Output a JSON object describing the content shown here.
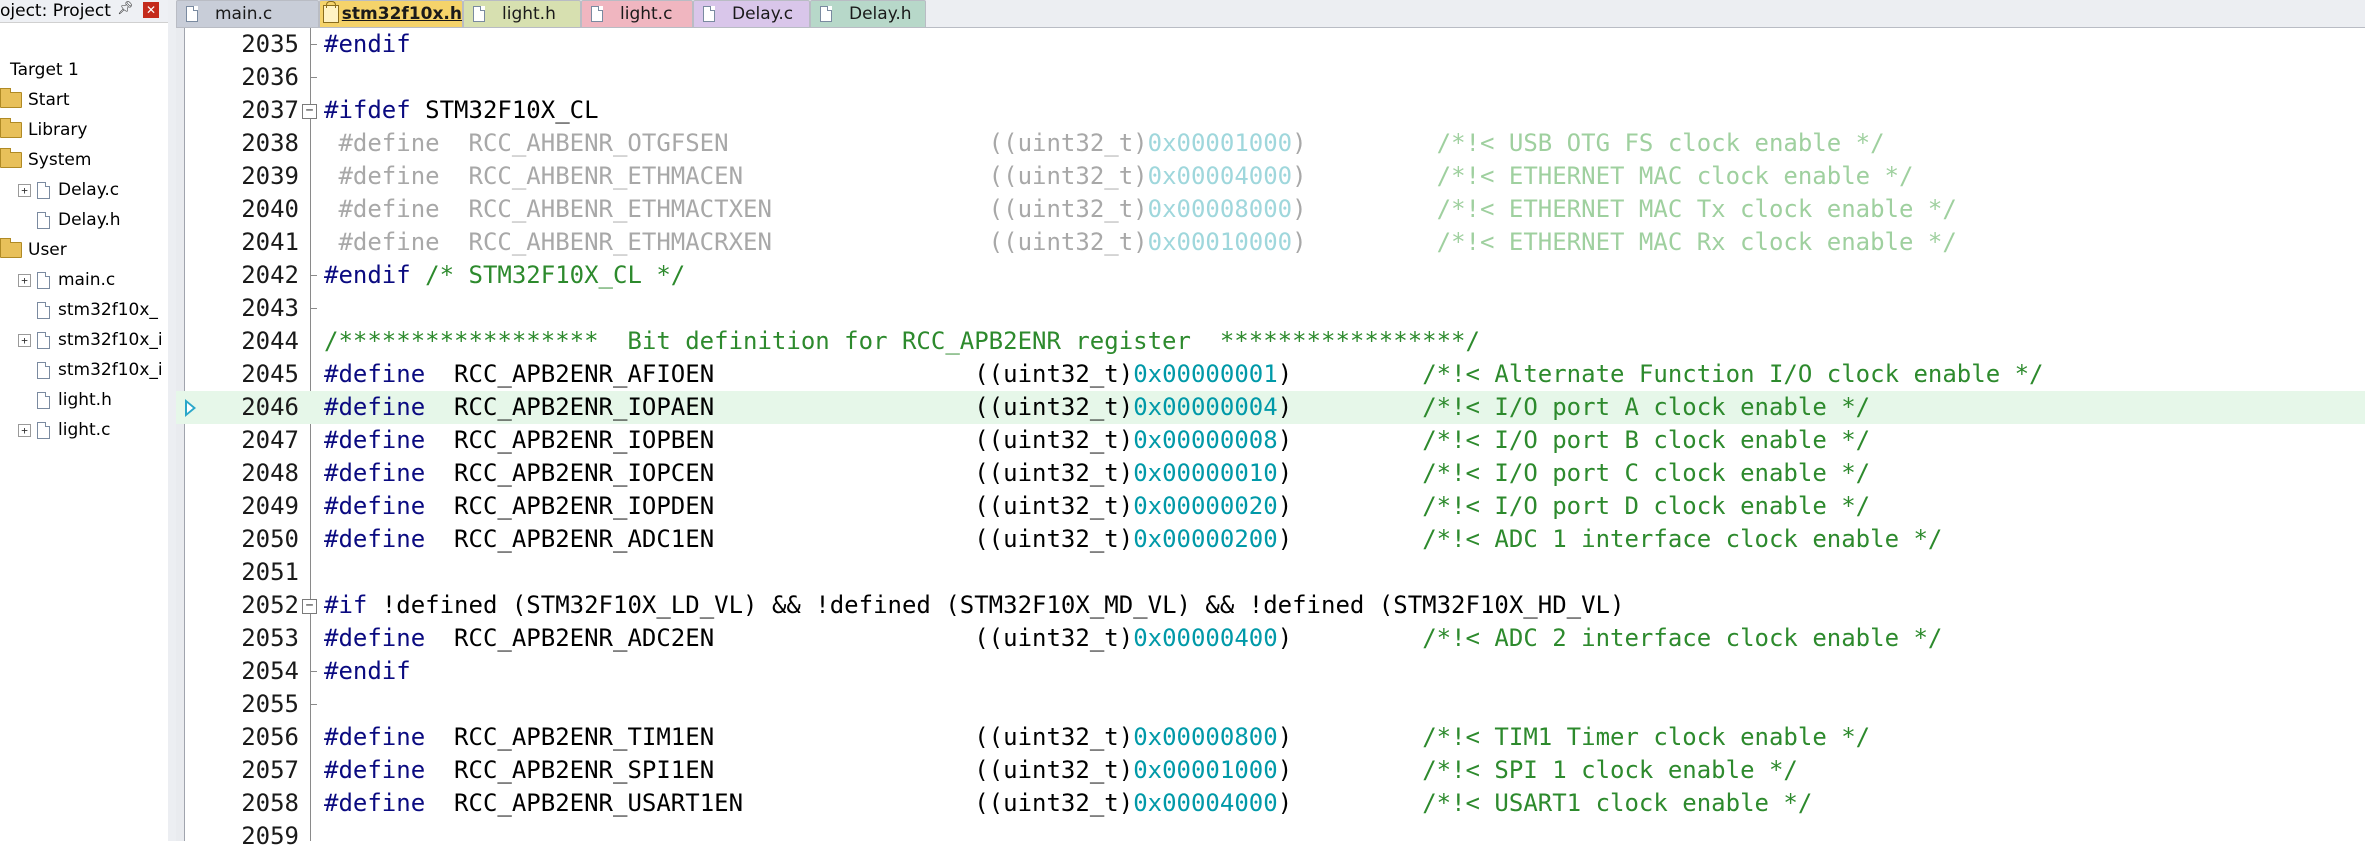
{
  "project_panel": {
    "title": "oject: Project",
    "pin_icon": "pin-icon",
    "close_icon": "close-icon",
    "items": [
      {
        "label": "Target 1",
        "level": 0,
        "type": "target",
        "expander": "",
        "icon": "target-icon"
      },
      {
        "label": "Start",
        "level": 1,
        "type": "folder",
        "expander": "",
        "icon": "folder-icon"
      },
      {
        "label": "Library",
        "level": 1,
        "type": "folder",
        "expander": "",
        "icon": "folder-icon"
      },
      {
        "label": "System",
        "level": 1,
        "type": "folder-open",
        "expander": "",
        "icon": "folder-open-icon"
      },
      {
        "label": "Delay.c",
        "level": 2,
        "type": "file",
        "expander": "+",
        "icon": "file-icon"
      },
      {
        "label": "Delay.h",
        "level": 2,
        "type": "file",
        "expander": "",
        "icon": "file-icon"
      },
      {
        "label": "User",
        "level": 1,
        "type": "folder-open",
        "expander": "",
        "icon": "folder-open-icon"
      },
      {
        "label": "main.c",
        "level": 2,
        "type": "file",
        "expander": "+",
        "icon": "file-icon"
      },
      {
        "label": "stm32f10x_",
        "level": 2,
        "type": "file",
        "expander": "",
        "icon": "file-icon"
      },
      {
        "label": "stm32f10x_i",
        "level": 2,
        "type": "file",
        "expander": "+",
        "icon": "file-icon"
      },
      {
        "label": "stm32f10x_i",
        "level": 2,
        "type": "file",
        "expander": "",
        "icon": "file-icon"
      },
      {
        "label": "light.h",
        "level": 2,
        "type": "file",
        "expander": "",
        "icon": "file-icon"
      },
      {
        "label": "light.c",
        "level": 2,
        "type": "file",
        "expander": "+",
        "icon": "file-icon"
      }
    ]
  },
  "tabs": [
    {
      "label": "main.c",
      "color": "#c8cdd8",
      "active": false,
      "icon": "file-icon"
    },
    {
      "label": "stm32f10x.h",
      "color": "#f5d36a",
      "active": true,
      "icon": "file-edit-icon"
    },
    {
      "label": "light.h",
      "color": "#d7e0b0",
      "active": false,
      "icon": "file-icon"
    },
    {
      "label": "light.c",
      "color": "#f0b6c0",
      "active": false,
      "icon": "file-icon"
    },
    {
      "label": "Delay.c",
      "color": "#d9c6ea",
      "active": false,
      "icon": "file-icon"
    },
    {
      "label": "Delay.h",
      "color": "#b7d8c9",
      "active": false,
      "icon": "file-icon"
    }
  ],
  "editor": {
    "current_line": "2046",
    "lines": [
      {
        "num": "2035",
        "fold": "end",
        "tokens": [
          {
            "t": "#endif",
            "c": "pp"
          }
        ]
      },
      {
        "num": "2036",
        "fold": "end",
        "tokens": []
      },
      {
        "num": "2037",
        "fold": "open",
        "tokens": [
          {
            "t": "#ifdef",
            "c": "pp"
          },
          {
            "t": " STM32F10X_CL",
            "c": "id"
          }
        ]
      },
      {
        "num": "2038",
        "fold": "none",
        "tokens": [
          {
            "t": " #define",
            "c": "pp-dim"
          },
          {
            "t": "  RCC_AHBENR_OTGFSEN                  ",
            "c": "id-dim"
          },
          {
            "t": "((uint32_t)",
            "c": "id-dim"
          },
          {
            "t": "0x00001000",
            "c": "hex-dim"
          },
          {
            "t": ")         ",
            "c": "id-dim"
          },
          {
            "t": "/*!< USB OTG FS clock enable */",
            "c": "cmt-dim"
          }
        ]
      },
      {
        "num": "2039",
        "fold": "none",
        "tokens": [
          {
            "t": " #define",
            "c": "pp-dim"
          },
          {
            "t": "  RCC_AHBENR_ETHMACEN                 ",
            "c": "id-dim"
          },
          {
            "t": "((uint32_t)",
            "c": "id-dim"
          },
          {
            "t": "0x00004000",
            "c": "hex-dim"
          },
          {
            "t": ")         ",
            "c": "id-dim"
          },
          {
            "t": "/*!< ETHERNET MAC clock enable */",
            "c": "cmt-dim"
          }
        ]
      },
      {
        "num": "2040",
        "fold": "none",
        "tokens": [
          {
            "t": " #define",
            "c": "pp-dim"
          },
          {
            "t": "  RCC_AHBENR_ETHMACTXEN               ",
            "c": "id-dim"
          },
          {
            "t": "((uint32_t)",
            "c": "id-dim"
          },
          {
            "t": "0x00008000",
            "c": "hex-dim"
          },
          {
            "t": ")         ",
            "c": "id-dim"
          },
          {
            "t": "/*!< ETHERNET MAC Tx clock enable */",
            "c": "cmt-dim"
          }
        ]
      },
      {
        "num": "2041",
        "fold": "none",
        "tokens": [
          {
            "t": " #define",
            "c": "pp-dim"
          },
          {
            "t": "  RCC_AHBENR_ETHMACRXEN               ",
            "c": "id-dim"
          },
          {
            "t": "((uint32_t)",
            "c": "id-dim"
          },
          {
            "t": "0x00010000",
            "c": "hex-dim"
          },
          {
            "t": ")         ",
            "c": "id-dim"
          },
          {
            "t": "/*!< ETHERNET MAC Rx clock enable */",
            "c": "cmt-dim"
          }
        ]
      },
      {
        "num": "2042",
        "fold": "end",
        "tokens": [
          {
            "t": "#endif",
            "c": "pp"
          },
          {
            "t": " /* STM32F10X_CL */",
            "c": "cmt"
          }
        ]
      },
      {
        "num": "2043",
        "fold": "end",
        "tokens": []
      },
      {
        "num": "2044",
        "fold": "none",
        "tokens": [
          {
            "t": "/******************  Bit definition for RCC_APB2ENR register  *****************/",
            "c": "cmt"
          }
        ]
      },
      {
        "num": "2045",
        "fold": "none",
        "tokens": [
          {
            "t": "#define",
            "c": "pp"
          },
          {
            "t": "  RCC_APB2ENR_AFIOEN                  ",
            "c": "id"
          },
          {
            "t": "((uint32_t)",
            "c": "id"
          },
          {
            "t": "0x00000001",
            "c": "hex"
          },
          {
            "t": ")         ",
            "c": "id"
          },
          {
            "t": "/*!< Alternate Function I/O clock enable */",
            "c": "cmt"
          }
        ]
      },
      {
        "num": "2046",
        "fold": "none",
        "tokens": [
          {
            "t": "#define",
            "c": "pp"
          },
          {
            "t": "  RCC_APB2ENR_IOPAEN                  ",
            "c": "id"
          },
          {
            "t": "((uint32_t)",
            "c": "id"
          },
          {
            "t": "0x00000004",
            "c": "hex"
          },
          {
            "t": ")         ",
            "c": "id"
          },
          {
            "t": "/*!< I/O port A clock enable */",
            "c": "cmt"
          }
        ]
      },
      {
        "num": "2047",
        "fold": "none",
        "tokens": [
          {
            "t": "#define",
            "c": "pp"
          },
          {
            "t": "  RCC_APB2ENR_IOPBEN                  ",
            "c": "id"
          },
          {
            "t": "((uint32_t)",
            "c": "id"
          },
          {
            "t": "0x00000008",
            "c": "hex"
          },
          {
            "t": ")         ",
            "c": "id"
          },
          {
            "t": "/*!< I/O port B clock enable */",
            "c": "cmt"
          }
        ]
      },
      {
        "num": "2048",
        "fold": "none",
        "tokens": [
          {
            "t": "#define",
            "c": "pp"
          },
          {
            "t": "  RCC_APB2ENR_IOPCEN                  ",
            "c": "id"
          },
          {
            "t": "((uint32_t)",
            "c": "id"
          },
          {
            "t": "0x00000010",
            "c": "hex"
          },
          {
            "t": ")         ",
            "c": "id"
          },
          {
            "t": "/*!< I/O port C clock enable */",
            "c": "cmt"
          }
        ]
      },
      {
        "num": "2049",
        "fold": "none",
        "tokens": [
          {
            "t": "#define",
            "c": "pp"
          },
          {
            "t": "  RCC_APB2ENR_IOPDEN                  ",
            "c": "id"
          },
          {
            "t": "((uint32_t)",
            "c": "id"
          },
          {
            "t": "0x00000020",
            "c": "hex"
          },
          {
            "t": ")         ",
            "c": "id"
          },
          {
            "t": "/*!< I/O port D clock enable */",
            "c": "cmt"
          }
        ]
      },
      {
        "num": "2050",
        "fold": "none",
        "tokens": [
          {
            "t": "#define",
            "c": "pp"
          },
          {
            "t": "  RCC_APB2ENR_ADC1EN                  ",
            "c": "id"
          },
          {
            "t": "((uint32_t)",
            "c": "id"
          },
          {
            "t": "0x00000200",
            "c": "hex"
          },
          {
            "t": ")         ",
            "c": "id"
          },
          {
            "t": "/*!< ADC 1 interface clock enable */",
            "c": "cmt"
          }
        ]
      },
      {
        "num": "2051",
        "fold": "none",
        "tokens": []
      },
      {
        "num": "2052",
        "fold": "open",
        "tokens": [
          {
            "t": "#if",
            "c": "pp"
          },
          {
            "t": " !defined (STM32F10X_LD_VL) && !defined (STM32F10X_MD_VL) && !defined (STM32F10X_HD_VL)",
            "c": "id"
          }
        ]
      },
      {
        "num": "2053",
        "fold": "none",
        "tokens": [
          {
            "t": "#define",
            "c": "pp"
          },
          {
            "t": "  RCC_APB2ENR_ADC2EN                  ",
            "c": "id"
          },
          {
            "t": "((uint32_t)",
            "c": "id"
          },
          {
            "t": "0x00000400",
            "c": "hex"
          },
          {
            "t": ")         ",
            "c": "id"
          },
          {
            "t": "/*!< ADC 2 interface clock enable */",
            "c": "cmt"
          }
        ]
      },
      {
        "num": "2054",
        "fold": "end",
        "tokens": [
          {
            "t": "#endif",
            "c": "pp"
          }
        ]
      },
      {
        "num": "2055",
        "fold": "end",
        "tokens": []
      },
      {
        "num": "2056",
        "fold": "none",
        "tokens": [
          {
            "t": "#define",
            "c": "pp"
          },
          {
            "t": "  RCC_APB2ENR_TIM1EN                  ",
            "c": "id"
          },
          {
            "t": "((uint32_t)",
            "c": "id"
          },
          {
            "t": "0x00000800",
            "c": "hex"
          },
          {
            "t": ")         ",
            "c": "id"
          },
          {
            "t": "/*!< TIM1 Timer clock enable */",
            "c": "cmt"
          }
        ]
      },
      {
        "num": "2057",
        "fold": "none",
        "tokens": [
          {
            "t": "#define",
            "c": "pp"
          },
          {
            "t": "  RCC_APB2ENR_SPI1EN                  ",
            "c": "id"
          },
          {
            "t": "((uint32_t)",
            "c": "id"
          },
          {
            "t": "0x00001000",
            "c": "hex"
          },
          {
            "t": ")         ",
            "c": "id"
          },
          {
            "t": "/*!< SPI 1 clock enable */",
            "c": "cmt"
          }
        ]
      },
      {
        "num": "2058",
        "fold": "none",
        "tokens": [
          {
            "t": "#define",
            "c": "pp"
          },
          {
            "t": "  RCC_APB2ENR_USART1EN                ",
            "c": "id"
          },
          {
            "t": "((uint32_t)",
            "c": "id"
          },
          {
            "t": "0x00004000",
            "c": "hex"
          },
          {
            "t": ")         ",
            "c": "id"
          },
          {
            "t": "/*!< USART1 clock enable */",
            "c": "cmt"
          }
        ]
      },
      {
        "num": "2059",
        "fold": "none",
        "tokens": []
      }
    ]
  }
}
